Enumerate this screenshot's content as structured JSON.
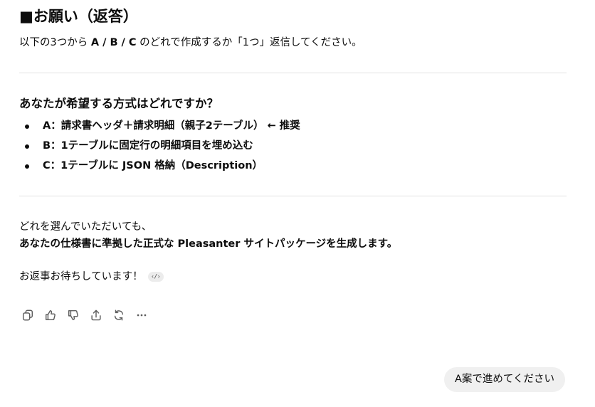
{
  "assistant_message": {
    "heading": "■お願い（返答）",
    "intro": {
      "before": "以下の3つから ",
      "options_bold": "A / B / C",
      "after": " のどれで作成するか「1つ」返信してください。"
    },
    "question": "あなたが希望する方式はどれですか？",
    "options": [
      "A：請求書ヘッダ＋請求明細（親子2テーブル） ← 推奨",
      "B：1テーブルに固定行の明細項目を埋め込む",
      "C：1テーブルに JSON 格納（Description）"
    ],
    "closing_line1": "どれを選んでいただいても、",
    "closing_line2": "あなたの仕様書に準拠した正式な Pleasanter サイトパッケージを生成します。",
    "waiting": "お返事お待ちしています！",
    "code_chip": "‹/›"
  },
  "message_actions": {
    "icons": [
      "copy-icon",
      "thumbs-up-icon",
      "thumbs-down-icon",
      "share-icon",
      "regenerate-icon",
      "more-icon"
    ]
  },
  "user_message": {
    "text": "A案で進めてください"
  }
}
